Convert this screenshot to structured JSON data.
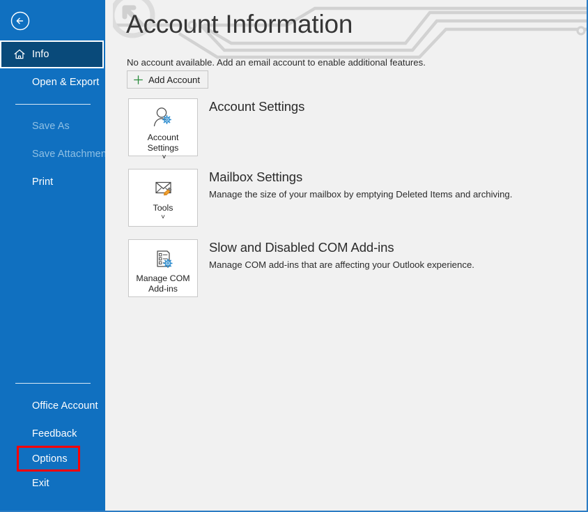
{
  "window": {
    "accent_color": "#1070c0",
    "selected_color": "#094a7a",
    "highlight_color": "#ff0000",
    "content_bg": "#f1f1f1"
  },
  "sidebar": {
    "back_button": {
      "name": "back-arrow-button",
      "label": "Back"
    },
    "items": [
      {
        "label": "Info",
        "icon": "home-icon",
        "state": "selected"
      },
      {
        "label": "Open & Export",
        "icon": "",
        "state": "normal"
      },
      {
        "label": "Save As",
        "icon": "",
        "state": "disabled"
      },
      {
        "label": "Save Attachments",
        "icon": "",
        "state": "disabled"
      },
      {
        "label": "Print",
        "icon": "",
        "state": "normal"
      }
    ],
    "bottom_items": [
      {
        "label": "Office Account",
        "state": "normal"
      },
      {
        "label": "Feedback",
        "state": "normal"
      },
      {
        "label": "Options",
        "state": "highlighted"
      },
      {
        "label": "Exit",
        "state": "normal"
      }
    ]
  },
  "main": {
    "title": "Account Information",
    "no_account_message": "No account available. Add an email account to enable additional features.",
    "add_account_button": "Add Account",
    "sections": [
      {
        "button_label": "Account\nSettings",
        "button_has_chevron": true,
        "button_chevron": "˅",
        "icon": "person-gear-icon",
        "heading": "Account Settings",
        "description": ""
      },
      {
        "button_label": "Tools",
        "button_has_chevron": true,
        "button_chevron": "˅",
        "icon": "envelope-broom-icon",
        "heading": "Mailbox Settings",
        "description": "Manage the size of your mailbox by emptying Deleted Items and archiving."
      },
      {
        "button_label": "Manage COM\nAdd-ins",
        "button_has_chevron": false,
        "button_chevron": "",
        "icon": "addins-gear-icon",
        "heading": "Slow and Disabled COM Add-ins",
        "description": "Manage COM add-ins that are affecting your Outlook experience."
      }
    ]
  }
}
